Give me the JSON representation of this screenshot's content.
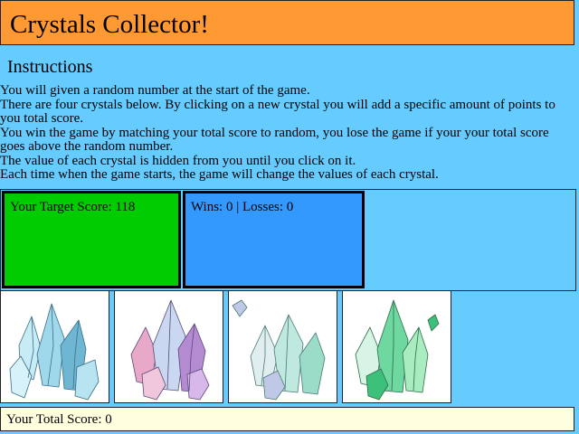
{
  "header": {
    "title": "Crystals Collector!"
  },
  "instructions": {
    "heading": "Instructions",
    "lines": [
      "You will given a random number at the start of the game.",
      "There are four crystals below. By clicking on a new crystal you will add a specific amount of points to you total score.",
      "You win the game by matching your total score to random, you lose the game if your your total score goes above the random number.",
      "The value of each crystal is hidden from you until you click on it.",
      "Each time when the game starts, the game will change the values of each crystal."
    ]
  },
  "scoreboard": {
    "target_label": "Your Target Score: 118",
    "wins_losses_label": "Wins: 0 | Losses: 0"
  },
  "crystals": [
    {
      "name": "crystal-blue",
      "colors": [
        "#9fd8ea",
        "#c8ecf5",
        "#6fb6d3"
      ]
    },
    {
      "name": "crystal-pink",
      "colors": [
        "#e8a8c8",
        "#c9d8f0",
        "#b48ad0"
      ]
    },
    {
      "name": "crystal-mint",
      "colors": [
        "#bfe8de",
        "#9adcc8",
        "#c0c8e8"
      ]
    },
    {
      "name": "crystal-green",
      "colors": [
        "#6ed8a0",
        "#a8ecc0",
        "#3cc07a"
      ]
    }
  ],
  "total": {
    "label": "Your Total Score: 0"
  },
  "colors": {
    "background": "#66ccff",
    "header": "#ff9933",
    "target_box": "#00cc00",
    "wins_box": "#3399ff",
    "total_bar": "#ffffe0"
  }
}
